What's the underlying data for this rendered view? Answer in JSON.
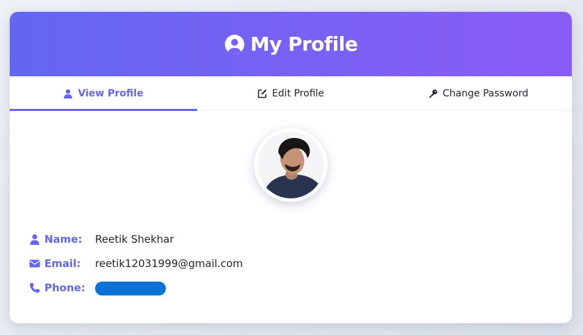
{
  "header": {
    "title": "My Profile",
    "icon": "user-circle-icon"
  },
  "tabs": [
    {
      "label": "View Profile",
      "icon": "user-icon",
      "active": true
    },
    {
      "label": "Edit Profile",
      "icon": "edit-icon",
      "active": false
    },
    {
      "label": "Change Password",
      "icon": "key-icon",
      "active": false
    }
  ],
  "profile": {
    "name_label": "Name:",
    "name": "Reetik Shekhar",
    "email_label": "Email:",
    "email": "reetik12031999@gmail.com",
    "phone_label": "Phone:"
  },
  "colors": {
    "accent": "#6366f1",
    "header_gradient_start": "#6366f1",
    "header_gradient_end": "#8b5cf6",
    "redaction": "#0b72d6"
  }
}
